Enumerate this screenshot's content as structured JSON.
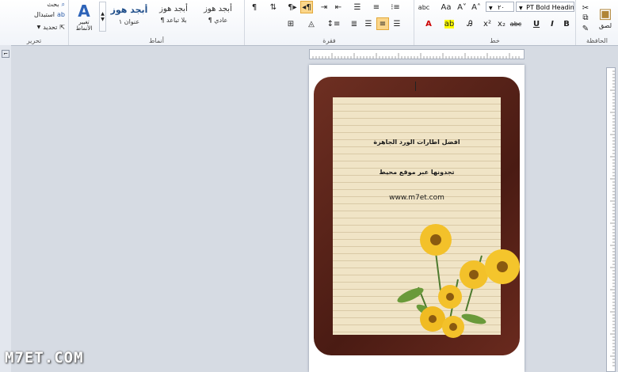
{
  "ribbon": {
    "editing": {
      "label": "تحرير",
      "find": "بحث",
      "replace": "استبدال",
      "select": "تحديد"
    },
    "styles": {
      "label": "أنماط",
      "change_styles": "تغيير الأنماط",
      "gallery": [
        {
          "sample": "أبجد هوز",
          "name": "¶ عادي"
        },
        {
          "sample": "أبجد هوز",
          "name": "¶ بلا تباعد"
        },
        {
          "sample": "أبجد هوز",
          "name": "عنوان ١"
        }
      ]
    },
    "paragraph": {
      "label": "فقرة"
    },
    "font": {
      "label": "خط",
      "font_name": "PT Bold Heading",
      "font_size": "٢٠"
    },
    "clipboard": {
      "label": "الحافظة",
      "paste": "لصق"
    }
  },
  "document": {
    "line1": "افضل اطارات الورد الجاهزة",
    "line2": "تجدونها عبر موقع محيط",
    "line3": "www.m7et.com"
  },
  "watermark": "M7ET.COM",
  "colors": {
    "accent": "#fbd68a",
    "frame": "#5a2419",
    "paper": "#f0e4c6"
  }
}
